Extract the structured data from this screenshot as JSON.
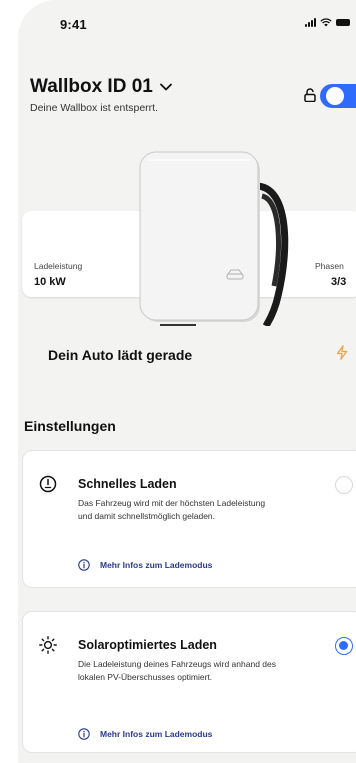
{
  "status_bar": {
    "time": "9:41"
  },
  "header": {
    "title": "Wallbox ID 01",
    "subtitle": "Deine Wallbox ist entsperrt."
  },
  "lock_toggle": {
    "state": "on",
    "accent": "#2f6bff"
  },
  "status_card": {
    "power_label": "Ladeleistung",
    "power_value": "10 kW",
    "phases_label": "Phasen",
    "phases_value": "3/3",
    "charging_text": "Dein Auto lädt gerade",
    "bolt_color": "#f0a24a"
  },
  "settings": {
    "title": "Einstellungen",
    "modes": [
      {
        "title": "Schnelles Laden",
        "description": "Das Fahrzeug wird mit der höchsten Ladeleistung und damit schnellstmöglich geladen.",
        "info_link": "Mehr Infos zum Lademodus",
        "icon": "power-gauge-icon",
        "selected": false
      },
      {
        "title": "Solaroptimiertes Laden",
        "description": "Die Ladeleistung deines Fahrzeugs wird anhand des lokalen PV-Überschusses optimiert.",
        "info_link": "Mehr Infos zum Lademodus",
        "icon": "sun-icon",
        "selected": true
      }
    ]
  }
}
